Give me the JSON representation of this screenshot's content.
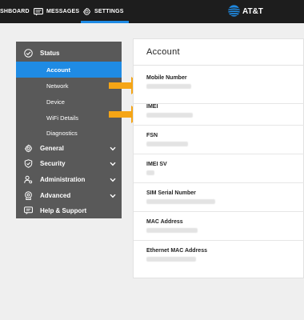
{
  "topbar": {
    "dashboard_label": "SHBOARD",
    "messages_label": "MESSAGES",
    "settings_label": "SETTINGS",
    "brand": "AT&T",
    "accent_color": "#1f8be4"
  },
  "sidebar": {
    "status": {
      "label": "Status",
      "icon": "check-circle-icon",
      "sub_items": [
        {
          "label": "Account",
          "active": true
        },
        {
          "label": "Network"
        },
        {
          "label": "Device"
        },
        {
          "label": "WiFi Details"
        },
        {
          "label": "Diagnostics"
        }
      ]
    },
    "sections": [
      {
        "label": "General",
        "icon": "gear-icon"
      },
      {
        "label": "Security",
        "icon": "shield-icon"
      },
      {
        "label": "Administration",
        "icon": "admin-user-icon"
      },
      {
        "label": "Advanced",
        "icon": "advanced-gear-icon"
      },
      {
        "label": "Help & Support",
        "icon": "chat-bubble-icon"
      }
    ]
  },
  "panel": {
    "title": "Account",
    "fields": [
      {
        "label": "Mobile Number"
      },
      {
        "label": "IMEI"
      },
      {
        "label": "FSN"
      },
      {
        "label": "IMEI SV"
      },
      {
        "label": "SIM Serial Number"
      },
      {
        "label": "MAC Address"
      },
      {
        "label": "Ethernet MAC Address"
      }
    ]
  },
  "colors": {
    "arrow": "#f5a516",
    "sidebar_bg": "#595959",
    "topbar_bg": "#1d1d1d"
  }
}
